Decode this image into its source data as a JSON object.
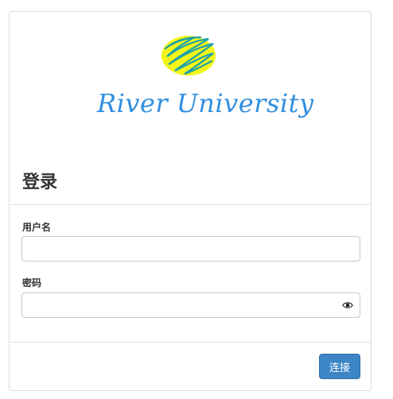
{
  "logo": {
    "text": "River University",
    "mark_icon": "scribble-logo-icon",
    "colors": {
      "text": "#2f8fe0",
      "mark_fill": "#f3f51a",
      "mark_stroke": "#1aa0a8"
    }
  },
  "login": {
    "title": "登录",
    "username_label": "用户名",
    "username_value": "",
    "password_label": "密码",
    "password_value": "",
    "password_toggle_icon": "eye-icon",
    "connect_label": "连接"
  },
  "colors": {
    "primary_button": "#3d86c6",
    "border": "#c9c9c9"
  }
}
